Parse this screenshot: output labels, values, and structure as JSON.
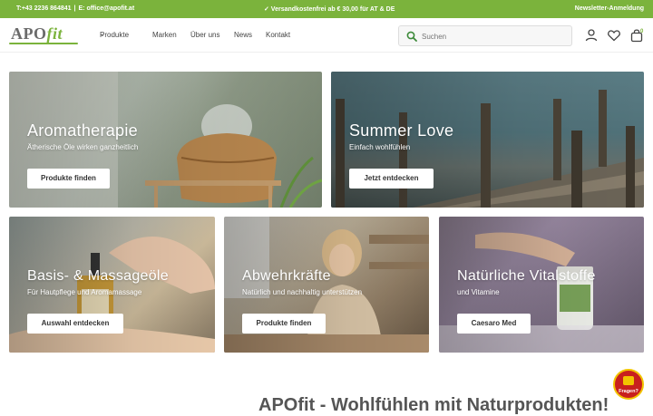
{
  "topbar": {
    "contact_phone": "T:+43 2236 864841",
    "separator": "|",
    "contact_email": "E: office@apofit.at",
    "shipping": "✓ Versandkostenfrei ab € 30,00 für AT & DE",
    "newsletter": "Newsletter-Anmeldung"
  },
  "logo": {
    "part1": "APO",
    "part2": "fit"
  },
  "nav": {
    "items": [
      "Produkte",
      "Marken",
      "Über uns",
      "News",
      "Kontakt"
    ]
  },
  "search": {
    "placeholder": "Suchen"
  },
  "cart": {
    "count": "0"
  },
  "tiles": [
    {
      "title": "Aromatherapie",
      "subtitle": "Ätherische Öle wirken ganzheitlich",
      "button": "Produkte finden"
    },
    {
      "title": "Summer Love",
      "subtitle": "Einfach wohlfühlen",
      "button": "Jetzt entdecken"
    },
    {
      "title": "Basis- & Massageöle",
      "subtitle": "Für Hautpflege und Aromamassage",
      "button": "Auswahl entdecken"
    },
    {
      "title": "Abwehrkräfte",
      "subtitle": "Natürlich und nachhaltig unterstützen",
      "button": "Produkte finden"
    },
    {
      "title": "Natürliche Vitalstoffe",
      "subtitle": "und Vitamine",
      "button": "Caesaro Med"
    }
  ],
  "headline": "APOfit - Wohlfühlen mit Naturprodukten!",
  "chat_widget": {
    "label": "Fragen?"
  },
  "colors": {
    "brand_green": "#7bb33c",
    "chat_red": "#c8201e"
  }
}
